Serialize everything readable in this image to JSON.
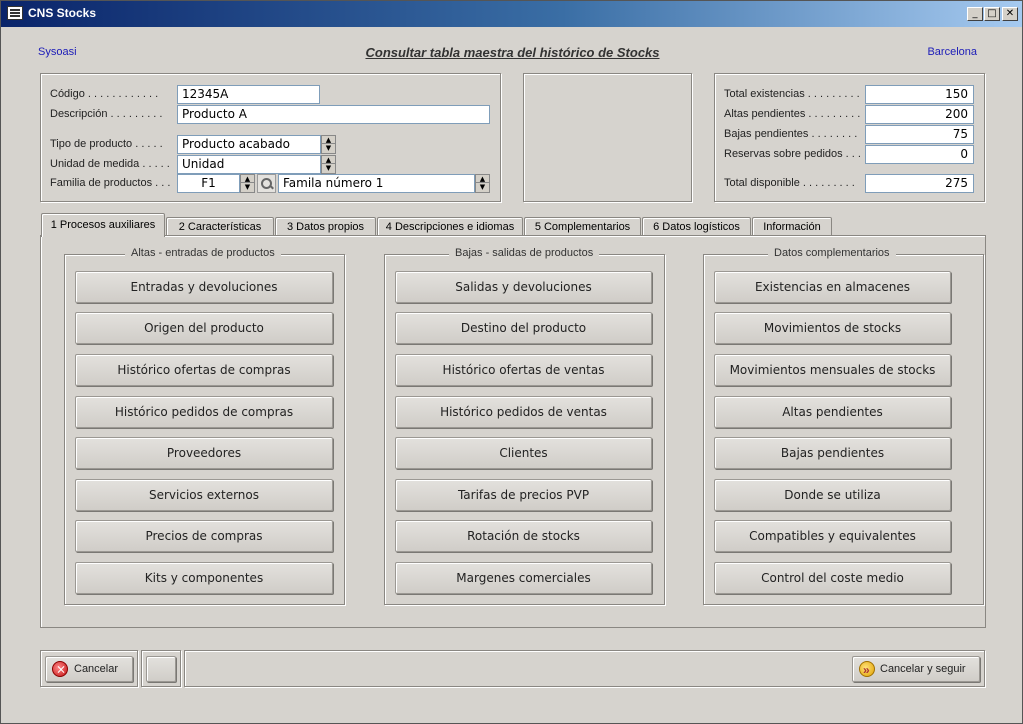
{
  "window": {
    "title": "CNS Stocks",
    "minimize": "_",
    "maximize": "□",
    "close": "✕"
  },
  "header": {
    "company": "Sysoasi",
    "title": "Consultar tabla maestra del histórico de Stocks",
    "location": "Barcelona"
  },
  "product": {
    "codigo_label": "Código . . . . . . . . . . . .",
    "codigo_value": "12345A",
    "descripcion_label": "Descripción . . . . . . . . .",
    "descripcion_value": "Producto A",
    "tipo_label": "Tipo de producto . . . . .",
    "tipo_value": "Producto acabado",
    "unidad_label": "Unidad de medida . . . . .",
    "unidad_value": "Unidad",
    "familia_label": "Familia de productos . . .",
    "familia_code": "F1",
    "familia_name": "Famila número 1"
  },
  "totals": {
    "existencias_label": "Total existencias . . . . . . . . .",
    "existencias_value": "150",
    "altas_label": "Altas pendientes . . . . . . . . .",
    "altas_value": "200",
    "bajas_label": "Bajas pendientes . . . . . . . .",
    "bajas_value": "75",
    "reservas_label": "Reservas sobre pedidos . . .",
    "reservas_value": "0",
    "disponible_label": "Total disponible . . . . . . . . .",
    "disponible_value": "275"
  },
  "tabs": [
    {
      "label": "1  Procesos auxiliares"
    },
    {
      "label": "2  Características"
    },
    {
      "label": "3  Datos propios"
    },
    {
      "label": "4  Descripciones e idiomas"
    },
    {
      "label": "5  Complementarios"
    },
    {
      "label": "6  Datos logísticos"
    },
    {
      "label": "Información"
    }
  ],
  "groups": [
    {
      "title": "Altas - entradas de productos",
      "buttons": [
        "Entradas y devoluciones",
        "Origen del producto",
        "Histórico ofertas de compras",
        "Histórico pedidos de compras",
        "Proveedores",
        "Servicios externos",
        "Precios de compras",
        "Kits y componentes"
      ]
    },
    {
      "title": "Bajas - salidas de productos",
      "buttons": [
        "Salidas y devoluciones",
        "Destino del producto",
        "Histórico ofertas de ventas",
        "Histórico pedidos de ventas",
        "Clientes",
        "Tarifas de precios PVP",
        "Rotación de stocks",
        "Margenes comerciales"
      ]
    },
    {
      "title": "Datos complementarios",
      "buttons": [
        "Existencias en almacenes",
        "Movimientos de stocks",
        "Movimientos mensuales de stocks",
        "Altas pendientes",
        "Bajas pendientes",
        "Donde se utiliza",
        "Compatibles y equivalentes",
        "Control del coste medio"
      ]
    }
  ],
  "footer": {
    "cancel_label": "Cancelar",
    "cancel_continue_label": "Cancelar y seguir"
  }
}
